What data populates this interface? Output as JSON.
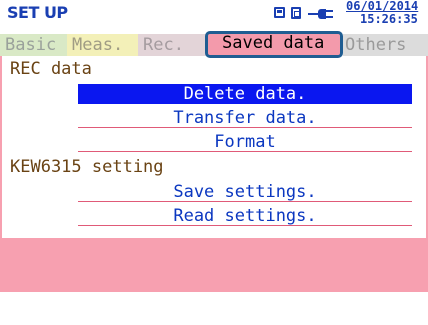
{
  "header": {
    "title": "SET UP",
    "date": "06/01/2014",
    "time": "15:26:35",
    "icons": [
      "sd-card-icon",
      "usb-icon",
      "power-plug-icon"
    ]
  },
  "tabs": [
    {
      "label": "Basic",
      "active": false
    },
    {
      "label": "Meas.",
      "active": false
    },
    {
      "label": "Rec.",
      "active": false
    },
    {
      "label": "Saved data",
      "active": true
    },
    {
      "label": "Others",
      "active": false
    }
  ],
  "sections": [
    {
      "title": "REC data",
      "items": [
        {
          "label": "Delete data.",
          "selected": true
        },
        {
          "label": "Transfer data.",
          "selected": false
        },
        {
          "label": "Format",
          "selected": false
        }
      ]
    },
    {
      "title": "KEW6315 setting",
      "items": [
        {
          "label": "Save settings.",
          "selected": false
        },
        {
          "label": "Read settings.",
          "selected": false
        }
      ]
    }
  ],
  "colors": {
    "accent": "#1a3fb2",
    "selection": "#0a17f0",
    "panel": "#f7a0b0",
    "active_tab_border": "#1f5d92"
  }
}
